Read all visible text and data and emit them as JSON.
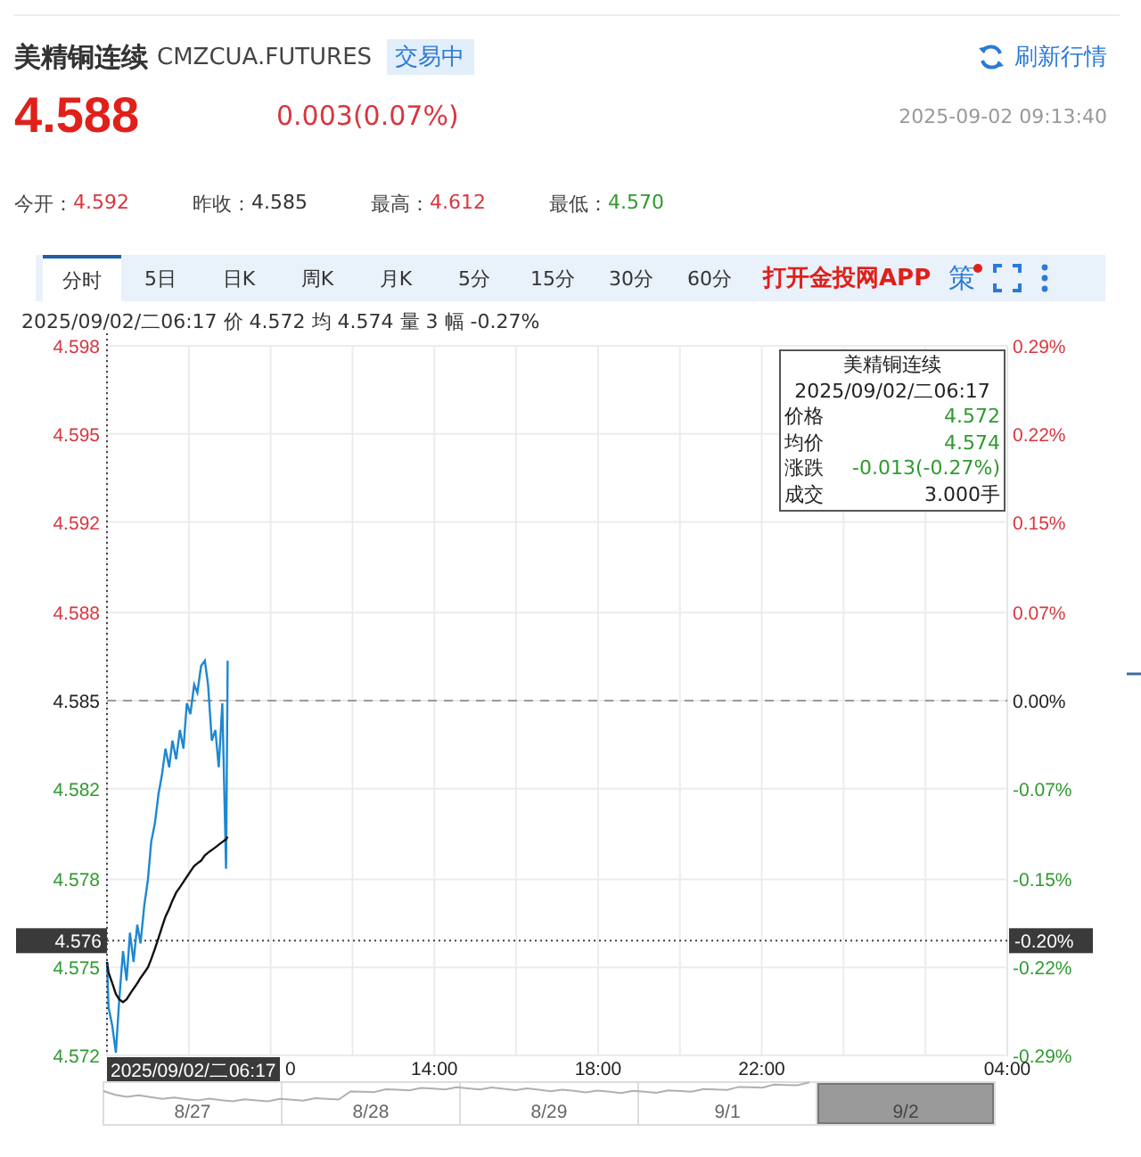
{
  "header": {
    "name": "美精铜连续",
    "code": "CMZCUA.FUTURES",
    "status": "交易中",
    "refresh": "刷新行情"
  },
  "quote": {
    "price": "4.588",
    "change": "0.003(0.07%)",
    "time": "2025-09-02 09:13:40"
  },
  "stats": [
    {
      "label": "今开：",
      "value": "4.592",
      "color": "#d9363e"
    },
    {
      "label": "昨收：",
      "value": "4.585",
      "color": "#333333"
    },
    {
      "label": "最高：",
      "value": "4.612",
      "color": "#d9363e"
    },
    {
      "label": "最低：",
      "value": "4.570",
      "color": "#2f9a2f"
    }
  ],
  "tabs": [
    {
      "label": "分时",
      "selected": true
    },
    {
      "label": "5日",
      "selected": false
    },
    {
      "label": "日K",
      "selected": false
    },
    {
      "label": "周K",
      "selected": false
    },
    {
      "label": "月K",
      "selected": false
    },
    {
      "label": "5分",
      "selected": false
    },
    {
      "label": "15分",
      "selected": false
    },
    {
      "label": "30分",
      "selected": false
    },
    {
      "label": "60分",
      "selected": false
    }
  ],
  "app_link": "打开金投网APP",
  "strategy": {
    "label": "策",
    "alert": true
  },
  "info_line": "2025/09/02/二06:17 价 4.572 均 4.574 量 3 幅 -0.27%",
  "chart": {
    "chart_data": {
      "type": "line",
      "xlim": [
        6,
        28
      ],
      "ylim": [
        4.5717,
        4.5983
      ],
      "grid": true,
      "xticks": [
        {
          "value": 14,
          "label": "14:00"
        },
        {
          "value": 18,
          "label": "18:00"
        },
        {
          "value": 22,
          "label": "22:00"
        }
      ],
      "yticks": [
        {
          "value": 4.5717,
          "label": "4.572"
        },
        {
          "value": 4.575,
          "label": "4.575"
        },
        {
          "value": 4.5783,
          "label": "4.578"
        },
        {
          "value": 4.5817,
          "label": "4.582"
        },
        {
          "value": 4.585,
          "label": "4.585"
        },
        {
          "value": 4.5883,
          "label": "4.588"
        },
        {
          "value": 4.5917,
          "label": "4.592"
        },
        {
          "value": 4.595,
          "label": "4.595"
        },
        {
          "value": 4.5983,
          "label": "4.598"
        }
      ],
      "x": [
        6.0,
        6.04,
        6.13,
        6.22,
        6.3,
        6.39,
        6.48,
        6.56,
        6.65,
        6.74,
        6.82,
        6.91,
        7.0,
        7.08,
        7.17,
        7.26,
        7.34,
        7.43,
        7.52,
        7.6,
        7.69,
        7.78,
        7.87,
        7.95,
        8.04,
        8.13,
        8.21,
        8.3,
        8.39,
        8.47,
        8.56,
        8.65,
        8.73,
        8.82,
        8.91,
        8.95
      ],
      "series": [
        {
          "color": "#1e88d0",
          "values": [
            4.5752,
            4.5735,
            4.5728,
            4.5718,
            4.5738,
            4.5756,
            4.5745,
            4.5763,
            4.5752,
            4.5766,
            4.5759,
            4.5773,
            4.5783,
            4.5797,
            4.5804,
            4.5815,
            4.5822,
            4.5832,
            4.5825,
            4.5835,
            4.5828,
            4.5839,
            4.5832,
            4.5849,
            4.5845,
            4.5856,
            4.5853,
            4.5863,
            4.5865,
            4.5856,
            4.5835,
            4.5839,
            4.5825,
            4.5849,
            4.5787,
            4.5865
          ]
        },
        {
          "color": "#111111",
          "values": [
            4.5752,
            4.5748,
            4.5744,
            4.574,
            4.5738,
            4.5737,
            4.5738,
            4.574,
            4.5742,
            4.5744,
            4.5746,
            4.5748,
            4.575,
            4.5753,
            4.5757,
            4.5761,
            4.5765,
            4.5769,
            4.5772,
            4.5775,
            4.5778,
            4.578,
            4.5782,
            4.5784,
            4.5786,
            4.5788,
            4.5789,
            4.579,
            4.5792,
            4.5793,
            4.5794,
            4.5795,
            4.5796,
            4.5797,
            4.5798,
            4.5799
          ]
        }
      ],
      "ref_lines": [
        {
          "axis": "y",
          "value": 4.585
        },
        {
          "axis": "y",
          "value": 4.576,
          "label": "4.576"
        }
      ]
    },
    "crosshair": {
      "time_label": "2025/09/02/二06:17",
      "percent_label": "-0.20%"
    },
    "x_edge_labels": [
      "0",
      "04:00"
    ],
    "percent_labels": [
      "0.29%",
      "0.22%",
      "0.15%",
      "0.07%",
      "0.00%",
      "-0.07%",
      "-0.15%",
      "-0.22%",
      "-0.29%"
    ]
  },
  "tooltip": {
    "title": "美精铜连续",
    "time": "2025/09/02/二06:17",
    "rows": [
      {
        "label": "价格",
        "value": "4.572",
        "color": "#2f9a2f"
      },
      {
        "label": "均价",
        "value": "4.574",
        "color": "#2f9a2f"
      },
      {
        "label": "涨跌",
        "value": "-0.013(-0.27%)",
        "color": "#2f9a2f"
      },
      {
        "label": "成交",
        "value": "3.000手",
        "color": "#222222"
      }
    ]
  },
  "navigator": [
    {
      "label": "8/27",
      "selected": false
    },
    {
      "label": "8/28",
      "selected": false
    },
    {
      "label": "8/29",
      "selected": false
    },
    {
      "label": "9/1",
      "selected": false
    },
    {
      "label": "9/2",
      "selected": true
    }
  ]
}
